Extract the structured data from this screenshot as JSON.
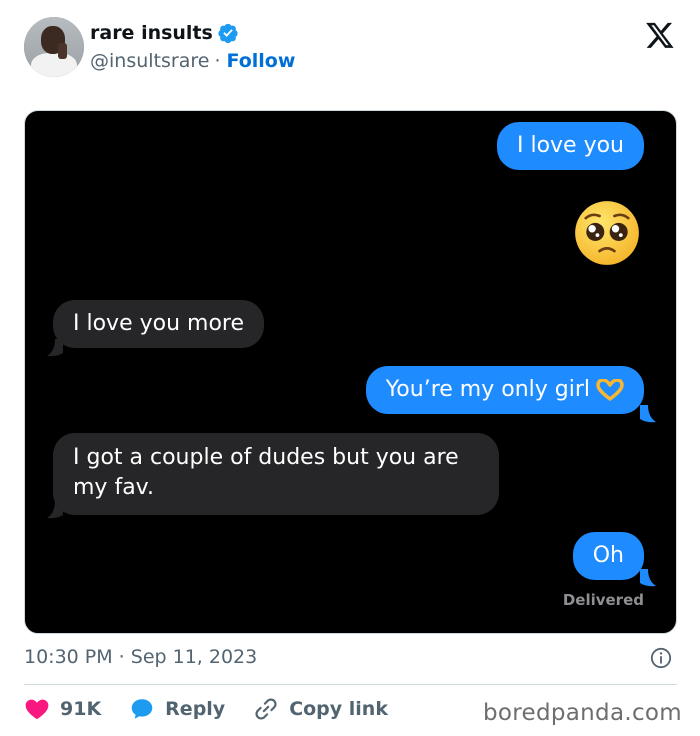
{
  "tweet": {
    "display_name": "rare insults",
    "handle": "@insultsrare",
    "separator": "·",
    "follow_label": "Follow",
    "timestamp": "10:30 PM · Sep 11, 2023"
  },
  "messages": [
    {
      "direction": "sent",
      "text": "I love you"
    },
    {
      "direction": "sent",
      "emoji": "pleading-face"
    },
    {
      "direction": "received",
      "text": "I love you more"
    },
    {
      "direction": "sent",
      "text": "You’re my only girl",
      "emoji": "heart-hands"
    },
    {
      "direction": "received",
      "text": "I got a couple of dudes but you are my fav."
    },
    {
      "direction": "sent",
      "text": "Oh"
    }
  ],
  "delivery_status": "Delivered",
  "actions": {
    "likes_count": "91K",
    "reply_label": "Reply",
    "copy_link_label": "Copy link"
  },
  "watermark": "boredpanda.com",
  "colors": {
    "sent_bubble": "#1e8bff",
    "received_bubble": "#262628",
    "follow": "#006fd6",
    "like": "#f91880",
    "reply": "#1d9bf0",
    "verified": "#1d9bf0"
  }
}
